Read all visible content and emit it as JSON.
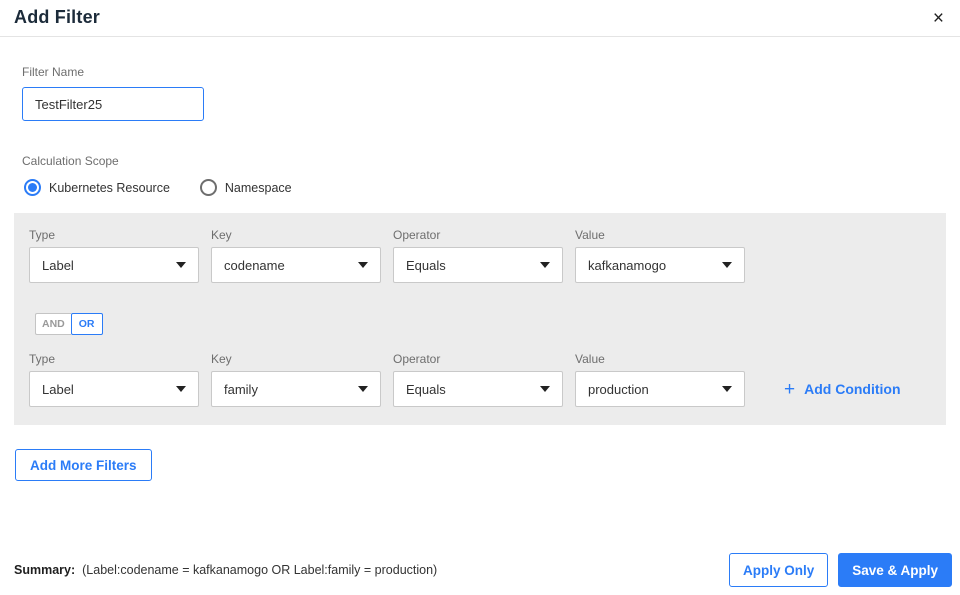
{
  "dialog": {
    "title": "Add Filter",
    "close_icon": "×"
  },
  "filter_name": {
    "label": "Filter Name",
    "value": "TestFilter25"
  },
  "calculation_scope": {
    "label": "Calculation Scope",
    "options": [
      {
        "label": "Kubernetes Resource",
        "selected": true
      },
      {
        "label": "Namespace",
        "selected": false
      }
    ]
  },
  "conditions": {
    "column_labels": {
      "type": "Type",
      "key": "Key",
      "operator": "Operator",
      "value": "Value"
    },
    "rows": [
      {
        "type": "Label",
        "key": "codename",
        "operator": "Equals",
        "value": "kafkanamogo"
      },
      {
        "type": "Label",
        "key": "family",
        "operator": "Equals",
        "value": "production"
      }
    ],
    "logic_toggle": {
      "and_label": "AND",
      "or_label": "OR",
      "selected": "OR"
    },
    "plus_icon": "+",
    "add_condition_label": "Add Condition"
  },
  "add_more_filters_label": "Add More Filters",
  "footer": {
    "summary_label": "Summary:",
    "summary_text": "(Label:codename = kafkanamogo OR Label:family = production)",
    "apply_only_label": "Apply Only",
    "save_apply_label": "Save & Apply"
  },
  "colors": {
    "accent_blue": "#2b7cf7",
    "panel_background": "#ececec"
  }
}
